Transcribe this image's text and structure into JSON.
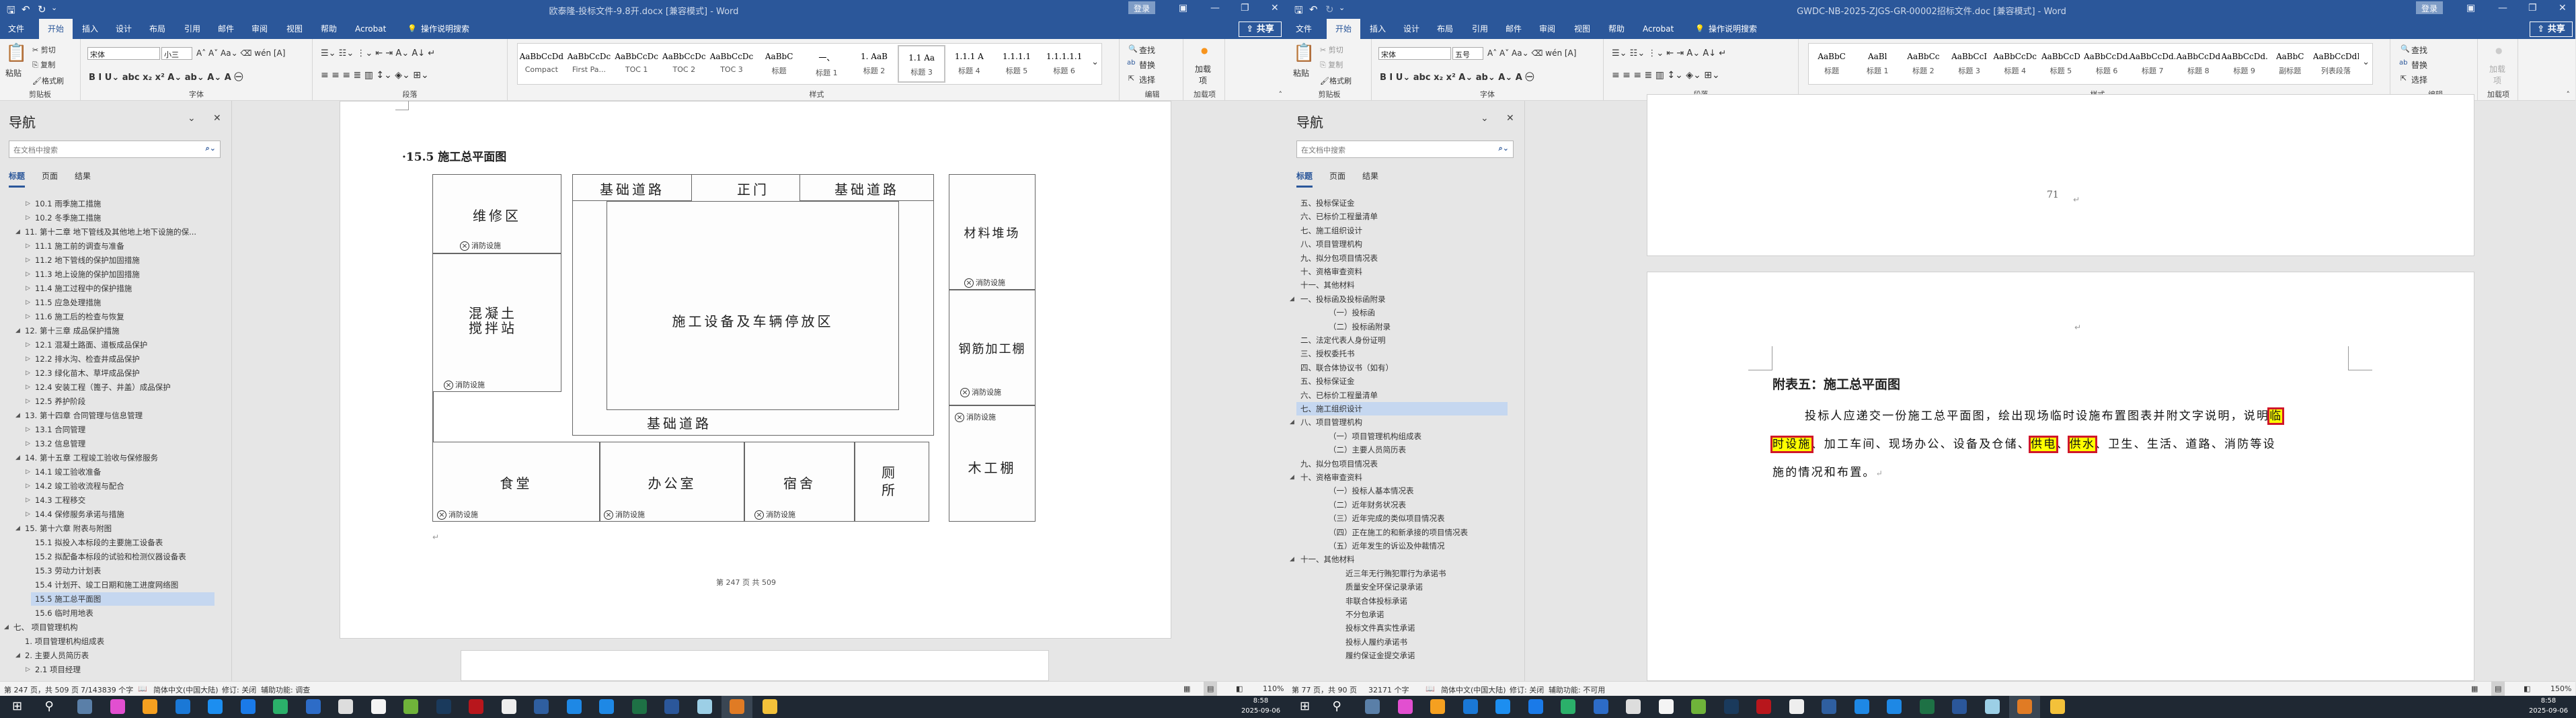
{
  "windows": [
    {
      "title": "欧泰隆-投标文件-9.8开.docx [兼容模式] - Word",
      "login": "登录",
      "share": "共享",
      "tabs": [
        "文件",
        "开始",
        "插入",
        "设计",
        "布局",
        "引用",
        "邮件",
        "审阅",
        "视图",
        "帮助",
        "Acrobat"
      ],
      "active_tab": 1,
      "tell_me": "操作说明搜索",
      "clipboard": {
        "paste": "粘贴",
        "cut": "剪切",
        "copy": "复制",
        "format_painter": "格式刷",
        "label": "剪贴板"
      },
      "font": {
        "name": "宋体",
        "size": "小三",
        "label": "字体"
      },
      "paragraph": {
        "label": "段落"
      },
      "styles": {
        "label": "样式",
        "selected": 8,
        "items": [
          {
            "preview": "AaBbCcDd",
            "label": "Compact"
          },
          {
            "preview": "AaBbCcDc",
            "label": "First Pa..."
          },
          {
            "preview": "AaBbCcDc",
            "label": "TOC 1"
          },
          {
            "preview": "AaBbCcDc",
            "label": "TOC 2"
          },
          {
            "preview": "AaBbCcDc",
            "label": "TOC 3"
          },
          {
            "preview": "AaBbC",
            "label": "标题"
          },
          {
            "preview": "一、",
            "label": "标题 1"
          },
          {
            "preview": "1. AaB",
            "label": "标题 2"
          },
          {
            "preview": "1.1 Aa",
            "label": "标题 3"
          },
          {
            "preview": "1.1.1 A",
            "label": "标题 4"
          },
          {
            "preview": "1.1.1.1",
            "label": "标题 5"
          },
          {
            "preview": "1.1.1.1.1",
            "label": "标题 6"
          }
        ]
      },
      "editing": {
        "find": "查找",
        "replace": "替换",
        "select": "选择",
        "label": "编辑"
      },
      "addins": {
        "button": "加载项",
        "label": "加载项"
      },
      "nav": {
        "title": "导航",
        "search_placeholder": "在文档中搜索",
        "tabs": [
          "标题",
          "页面",
          "结果"
        ],
        "items": [
          {
            "level": 2,
            "arrow": "closed",
            "text": "10.1 雨季施工措施"
          },
          {
            "level": 2,
            "arrow": "closed",
            "text": "10.2 冬季施工措施"
          },
          {
            "level": 1,
            "arrow": "open",
            "text": "11. 第十二章 地下管线及其他地上地下设施的保..."
          },
          {
            "level": 2,
            "arrow": "closed",
            "text": "11.1 施工前的调查与准备"
          },
          {
            "level": 2,
            "arrow": "closed",
            "text": "11.2 地下管线的保护加固措施"
          },
          {
            "level": 2,
            "arrow": "closed",
            "text": "11.3 地上设施的保护加固措施"
          },
          {
            "level": 2,
            "arrow": "closed",
            "text": "11.4 施工过程中的保护措施"
          },
          {
            "level": 2,
            "arrow": "closed",
            "text": "11.5 应急处理措施"
          },
          {
            "level": 2,
            "arrow": "closed",
            "text": "11.6 施工后的检查与恢复"
          },
          {
            "level": 1,
            "arrow": "open",
            "text": "12. 第十三章 成品保护措施"
          },
          {
            "level": 2,
            "arrow": "closed",
            "text": "12.1 混凝土路面、道板成品保护"
          },
          {
            "level": 2,
            "arrow": "closed",
            "text": "12.2 排水沟、检查井成品保护"
          },
          {
            "level": 2,
            "arrow": "closed",
            "text": "12.3 绿化苗木、草坪成品保护"
          },
          {
            "level": 2,
            "arrow": "closed",
            "text": "12.4 安装工程（篦子、井盖）成品保护"
          },
          {
            "level": 2,
            "arrow": "closed",
            "text": "12.5 养护阶段"
          },
          {
            "level": 1,
            "arrow": "open",
            "text": "13. 第十四章 合同管理与信息管理"
          },
          {
            "level": 2,
            "arrow": "closed",
            "text": "13.1 合同管理"
          },
          {
            "level": 2,
            "arrow": "closed",
            "text": "13.2 信息管理"
          },
          {
            "level": 1,
            "arrow": "open",
            "text": "14. 第十五章 工程竣工验收与保修服务"
          },
          {
            "level": 2,
            "arrow": "closed",
            "text": "14.1 竣工验收准备"
          },
          {
            "level": 2,
            "arrow": "closed",
            "text": "14.2 竣工验收流程与配合"
          },
          {
            "level": 2,
            "arrow": "closed",
            "text": "14.3 工程移交"
          },
          {
            "level": 2,
            "arrow": "closed",
            "text": "14.4 保修服务承诺与措施"
          },
          {
            "level": 1,
            "arrow": "open",
            "text": "15. 第十六章 附表与附图"
          },
          {
            "level": 2,
            "arrow": "none",
            "text": "15.1 拟投入本标段的主要施工设备表"
          },
          {
            "level": 2,
            "arrow": "none",
            "text": "15.2 拟配备本标段的试验和检测仪器设备表"
          },
          {
            "level": 2,
            "arrow": "none",
            "text": "15.3 劳动力计划表"
          },
          {
            "level": 2,
            "arrow": "none",
            "text": "15.4 计划开、竣工日期和施工进度网络图"
          },
          {
            "level": 2,
            "arrow": "none",
            "text": "15.5 施工总平面图",
            "selected": true
          },
          {
            "level": 2,
            "arrow": "none",
            "text": "15.6 临时用地表"
          },
          {
            "level": 0,
            "arrow": "open",
            "text": "七、 项目管理机构"
          },
          {
            "level": 1,
            "arrow": "none",
            "text": "1. 项目管理机构组成表"
          },
          {
            "level": 1,
            "arrow": "open",
            "text": "2. 主要人员简历表"
          },
          {
            "level": 2,
            "arrow": "closed",
            "text": "2.1 项目经理"
          }
        ]
      },
      "status": {
        "page": "第 247 页，共 509 页",
        "words": "7/143839 个字",
        "language": "简体中文(中国大陆)",
        "track": "修订: 关闭",
        "accessibility": "辅助功能: 调查",
        "zoom": "110%"
      }
    },
    {
      "title": "GWDC-NB-2025-ZJGS-GR-00002招标文件.doc [兼容模式] - Word",
      "login": "登录",
      "share": "共享",
      "tabs": [
        "文件",
        "开始",
        "插入",
        "设计",
        "布局",
        "引用",
        "邮件",
        "审阅",
        "视图",
        "帮助",
        "Acrobat"
      ],
      "active_tab": 1,
      "tell_me": "操作说明搜索",
      "clipboard": {
        "paste": "粘贴",
        "cut": "剪切",
        "copy": "复制",
        "format_painter": "格式刷",
        "label": "剪贴板"
      },
      "font": {
        "name": "宋体",
        "size": "五号",
        "label": "字体"
      },
      "paragraph": {
        "label": "段落"
      },
      "styles": {
        "label": "样式",
        "selected": -1,
        "items": [
          {
            "preview": "AaBbC",
            "label": "标题"
          },
          {
            "preview": "AaBl",
            "label": "标题 1"
          },
          {
            "preview": "AaBbCc",
            "label": "标题 2"
          },
          {
            "preview": "AaBbCcI",
            "label": "标题 3"
          },
          {
            "preview": "AaBbCcDc",
            "label": "标题 4"
          },
          {
            "preview": "AaBbCcD",
            "label": "标题 5"
          },
          {
            "preview": "AaBbCcDd.",
            "label": "标题 6"
          },
          {
            "preview": "AaBbCcDd.",
            "label": "标题 7"
          },
          {
            "preview": "AaBbCcDd",
            "label": "标题 8"
          },
          {
            "preview": "AaBbCcDd.",
            "label": "标题 9"
          },
          {
            "preview": "AaBbC",
            "label": "副标题"
          },
          {
            "preview": "AaBbCcDdE",
            "label": "列表段落"
          }
        ]
      },
      "editing": {
        "find": "查找",
        "replace": "替换",
        "select": "选择",
        "label": "编辑"
      },
      "addins": {
        "button": "加载项",
        "label": "加载项"
      },
      "nav": {
        "title": "导航",
        "search_placeholder": "在文档中搜索",
        "tabs": [
          "标题",
          "页面",
          "结果"
        ],
        "items": [
          {
            "level": 0,
            "arrow": "none",
            "text": "五、投标保证金"
          },
          {
            "level": 0,
            "arrow": "none",
            "text": "六、已标价工程量清单"
          },
          {
            "level": 0,
            "arrow": "none",
            "text": "七、施工组织设计"
          },
          {
            "level": 0,
            "arrow": "none",
            "text": "八、项目管理机构"
          },
          {
            "level": 0,
            "arrow": "none",
            "text": "九、拟分包项目情况表"
          },
          {
            "level": 0,
            "arrow": "none",
            "text": "十、资格审查资料"
          },
          {
            "level": 0,
            "arrow": "none",
            "text": "十一、其他材料"
          },
          {
            "level": 0,
            "arrow": "open",
            "text": "一、投标函及投标函附录"
          },
          {
            "level": 1,
            "arrow": "none",
            "text": "（一）投标函"
          },
          {
            "level": 1,
            "arrow": "none",
            "text": "（二）投标函附录"
          },
          {
            "level": 0,
            "arrow": "none",
            "text": "二、法定代表人身份证明"
          },
          {
            "level": 0,
            "arrow": "none",
            "text": "三、授权委托书"
          },
          {
            "level": 0,
            "arrow": "none",
            "text": "四、联合体协议书（如有）"
          },
          {
            "level": 0,
            "arrow": "none",
            "text": "五、投标保证金"
          },
          {
            "level": 0,
            "arrow": "none",
            "text": "六、已标价工程量清单"
          },
          {
            "level": 0,
            "arrow": "none",
            "text": "七、施工组织设计",
            "selected": true
          },
          {
            "level": 0,
            "arrow": "open",
            "text": "八、项目管理机构"
          },
          {
            "level": 1,
            "arrow": "none",
            "text": "（一）项目管理机构组成表"
          },
          {
            "level": 1,
            "arrow": "none",
            "text": "（二）主要人员简历表"
          },
          {
            "level": 0,
            "arrow": "none",
            "text": "九、拟分包项目情况表"
          },
          {
            "level": 0,
            "arrow": "open",
            "text": "十、资格审查资料"
          },
          {
            "level": 1,
            "arrow": "none",
            "text": "（一）投标人基本情况表"
          },
          {
            "level": 1,
            "arrow": "none",
            "text": "（二）近年财务状况表"
          },
          {
            "level": 1,
            "arrow": "none",
            "text": "（三）近年完成的类似项目情况表"
          },
          {
            "level": 1,
            "arrow": "none",
            "text": "（四）正在施工的和新承接的项目情况表"
          },
          {
            "level": 1,
            "arrow": "none",
            "text": "（五）近年发生的诉讼及仲裁情况"
          },
          {
            "level": 0,
            "arrow": "open",
            "text": "十一、其他材料"
          },
          {
            "level": 2,
            "arrow": "none",
            "text": "近三年无行贿犯罪行为承诺书"
          },
          {
            "level": 2,
            "arrow": "none",
            "text": "质量安全环保记录承诺"
          },
          {
            "level": 2,
            "arrow": "none",
            "text": "非联合体投标承诺"
          },
          {
            "level": 2,
            "arrow": "none",
            "text": "不分包承诺"
          },
          {
            "level": 2,
            "arrow": "none",
            "text": "投标文件真实性承诺"
          },
          {
            "level": 2,
            "arrow": "none",
            "text": "投标人履约承诺书"
          },
          {
            "level": 2,
            "arrow": "none",
            "text": "履约保证金提交承诺"
          }
        ]
      },
      "status": {
        "page": "第 77 页，共 90 页",
        "words": "32171 个字",
        "language": "简体中文(中国大陆)",
        "track": "修订: 关闭",
        "accessibility": "辅助功能: 不可用",
        "zoom": "150%"
      }
    }
  ],
  "left_doc": {
    "heading": "·15.5  施工总平面图",
    "footer": "第 247 页 共 509",
    "diagram": {
      "repair": "维修区",
      "mixing": "混凝土搅拌站",
      "road_top_left": "基础道路",
      "gate": "正门",
      "road_top_right": "基础道路",
      "parking": "施工设备及车辆停放区",
      "road_bottom": "基础道路",
      "material_yard": "材料堆场",
      "rebar_shed": "钢筋加工棚",
      "carpentry_shed": "木工棚",
      "canteen": "食堂",
      "office": "办公室",
      "dormitory": "宿舍",
      "toilet": "厕所",
      "fire_facility": "消防设施"
    }
  },
  "right_doc": {
    "page_number": "71",
    "heading": "附表五：施工总平面图",
    "lines": [
      [
        {
          "text": "投标人应递交一份施工总平面图，绘出现场临时设施布置图表并附文字说明，说明"
        },
        {
          "text": "临",
          "highlight": true
        }
      ],
      [
        {
          "text": "时设施",
          "highlight": true
        },
        {
          "text": "、加工车间、现场办公、设备及仓储、"
        },
        {
          "text": "供电",
          "highlight": true
        },
        {
          "text": "、"
        },
        {
          "text": "供水",
          "highlight": true
        },
        {
          "text": "、卫生、生活、道路、消防等设"
        }
      ],
      [
        {
          "text": "施的情况和布置。"
        }
      ]
    ]
  },
  "taskbar": {
    "time": "8:58",
    "date": "2025-09-06",
    "icons": [
      {
        "name": "start",
        "color": "#ffffff"
      },
      {
        "name": "search",
        "color": "#ffffff"
      },
      {
        "name": "calculator",
        "color": "#5a7fa8"
      },
      {
        "name": "color-wheel-app",
        "color": "#e24fd0"
      },
      {
        "name": "photos-app",
        "color": "#f5a020"
      },
      {
        "name": "dots-app",
        "color": "#1a78d6"
      },
      {
        "name": "tencent-docs",
        "color": "#1c8ef0"
      },
      {
        "name": "browser-o",
        "color": "#1a7ae8"
      },
      {
        "name": "spiral-app",
        "color": "#2bb06a"
      },
      {
        "name": "ie-like-app",
        "color": "#2d6cc7"
      },
      {
        "name": "notepad-app",
        "color": "#dddddd"
      },
      {
        "name": "blank-doc-app",
        "color": "#f4f4f4"
      },
      {
        "name": "pen-app",
        "color": "#6fb33a"
      },
      {
        "name": "photoshop",
        "color": "#1a3a5c"
      },
      {
        "name": "acrobat",
        "color": "#b8161c"
      },
      {
        "name": "qq",
        "color": "#eeeeee"
      },
      {
        "name": "xmind-app",
        "color": "#2f5fa0"
      },
      {
        "name": "chat-app",
        "color": "#1e88e5"
      },
      {
        "name": "edge-app",
        "color": "#1e88e5"
      },
      {
        "name": "excel",
        "color": "#1e7145"
      },
      {
        "name": "word",
        "color": "#2b579a"
      },
      {
        "name": "glass-app",
        "color": "#9ccfe6"
      },
      {
        "name": "active-app",
        "color": "#e07b24"
      },
      {
        "name": "file-explorer",
        "color": "#f3c13a"
      }
    ]
  },
  "colors": {
    "word_blue": "#2b579a",
    "highlight": "#ffff00",
    "annotation_red": "#d0172a"
  }
}
